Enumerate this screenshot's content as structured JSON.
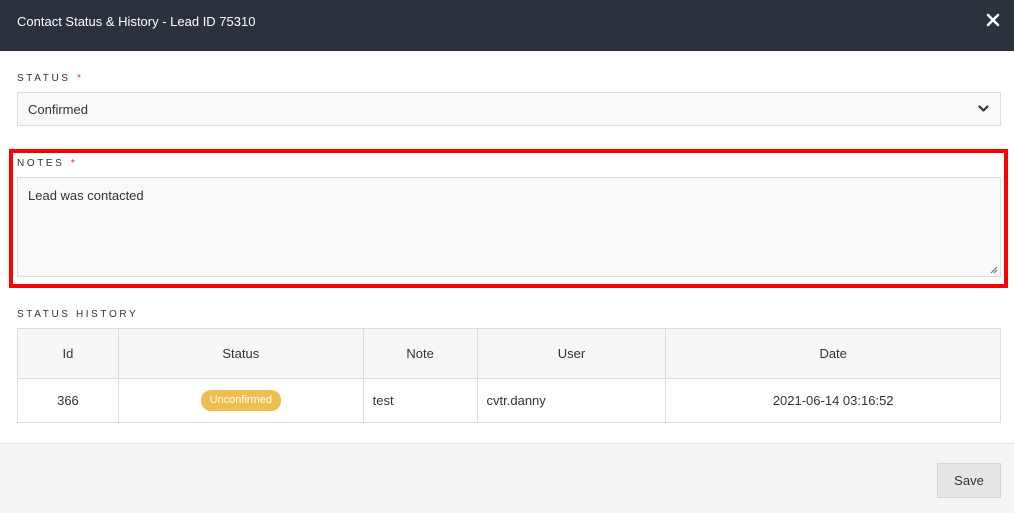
{
  "modal": {
    "title": "Contact Status & History - Lead ID 75310",
    "close_icon": "close-icon"
  },
  "status": {
    "label": "STATUS",
    "required_mark": "*",
    "selected": "Confirmed"
  },
  "notes": {
    "label": "NOTES",
    "required_mark": "*",
    "value": "Lead was contacted"
  },
  "history": {
    "label": "STATUS HISTORY",
    "columns": [
      "Id",
      "Status",
      "Note",
      "User",
      "Date"
    ],
    "rows": [
      {
        "id": "366",
        "status": "Unconfirmed",
        "note": "test",
        "user": "cvtr.danny",
        "date": "2021-06-14 03:16:52"
      }
    ]
  },
  "footer": {
    "save_label": "Save"
  },
  "colors": {
    "header_bg": "#2b323d",
    "required": "#e1262e",
    "badge_unconfirmed": "#f0be4f",
    "highlight": "#ff0000"
  }
}
